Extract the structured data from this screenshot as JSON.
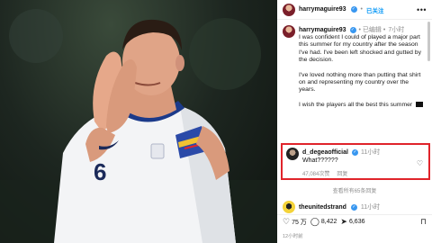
{
  "header": {
    "username": "harrymaguire93",
    "verified_badge": "✓",
    "separator": "•",
    "follow_label": "已关注",
    "more_icon": "more-horizontal-icon"
  },
  "caption": {
    "username": "harrymaguire93",
    "verified_badge": "✓",
    "edited": "• 已编辑 •",
    "time": "7小时",
    "paragraph_1": "I was confident I could of played a major part this summer for my country after the season I've had. I've been left shocked and gutted by the decision.",
    "paragraph_2": "I've loved nothing more than putting that shirt on and representing my country over the years.",
    "paragraph_3": "I wish the players all the best this summer"
  },
  "highlighted_comment": {
    "username": "d_degeaofficial",
    "verified_badge": "✓",
    "time": "11小时",
    "text": "What??????",
    "likes": "47,084次赞",
    "reply_label": "回复",
    "heart_icon": "heart-outline-icon"
  },
  "view_replies": "查看所有65条回复",
  "second_comment": {
    "username": "theunitedstrand",
    "verified_badge": "✓",
    "time": "11小时"
  },
  "actions": {
    "like_count": "75 万",
    "comment_count": "8,422",
    "share_count": "6,636"
  },
  "timestamp": "12小时前",
  "colors": {
    "highlight_border": "#e0242b",
    "link_blue": "#0095f6",
    "verified_blue": "#3897f0",
    "muted_gray": "#8e8e8e"
  }
}
